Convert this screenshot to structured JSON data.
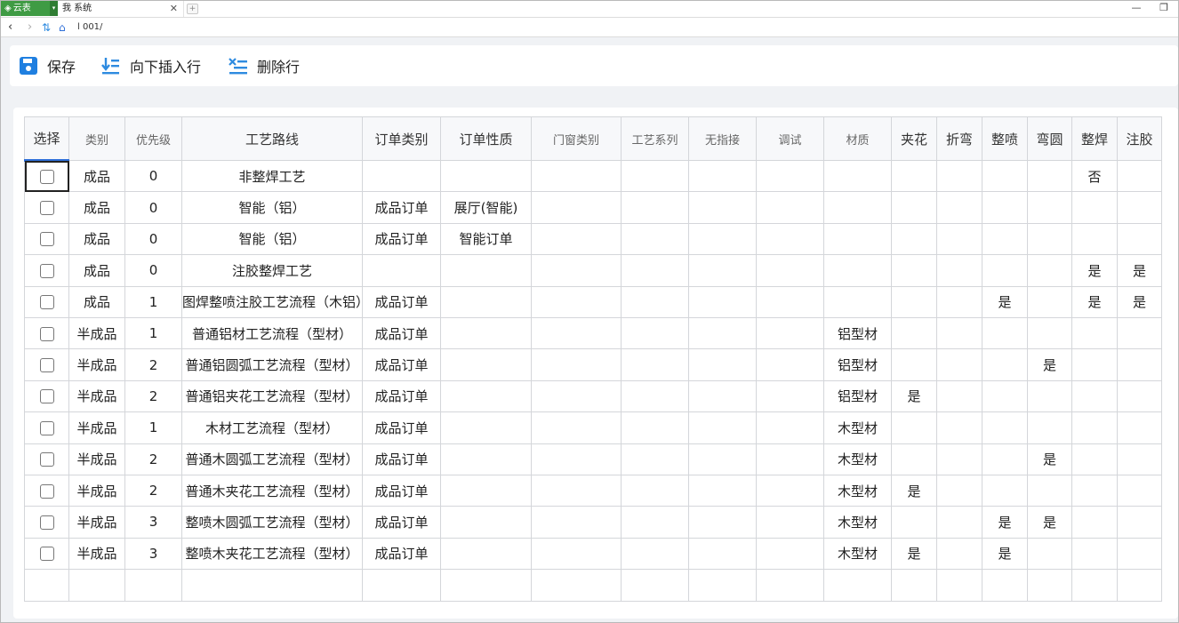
{
  "browser": {
    "brand": "云表",
    "tab_title": "我   系统",
    "url": "l              001/"
  },
  "toolbar": {
    "save_label": "保存",
    "insert_label": "向下插入行",
    "delete_label": "删除行"
  },
  "grid": {
    "headers": [
      "选择",
      "类别",
      "优先级",
      "工艺路线",
      "订单类别",
      "订单性质",
      "门窗类别",
      "工艺系列",
      "无指接",
      "调试",
      "材质",
      "夹花",
      "折弯",
      "整喷",
      "弯圆",
      "整焊",
      "注胶"
    ],
    "rows": [
      [
        "",
        "成品",
        "0",
        "非整焊工艺",
        "",
        "",
        "",
        "",
        "",
        "",
        "",
        "",
        "",
        "",
        "",
        "否",
        ""
      ],
      [
        "",
        "成品",
        "0",
        "智能（铝）",
        "成品订单",
        "展厅(智能)",
        "",
        "",
        "",
        "",
        "",
        "",
        "",
        "",
        "",
        "",
        ""
      ],
      [
        "",
        "成品",
        "0",
        "智能（铝）",
        "成品订单",
        "智能订单",
        "",
        "",
        "",
        "",
        "",
        "",
        "",
        "",
        "",
        "",
        ""
      ],
      [
        "",
        "成品",
        "0",
        "注胶整焊工艺",
        "",
        "",
        "",
        "",
        "",
        "",
        "",
        "",
        "",
        "",
        "",
        "是",
        "是"
      ],
      [
        "",
        "成品",
        "1",
        "图焊整喷注胶工艺流程（木铝）",
        "成品订单",
        "",
        "",
        "",
        "",
        "",
        "",
        "",
        "",
        "是",
        "",
        "是",
        "是"
      ],
      [
        "",
        "半成品",
        "1",
        "普通铝材工艺流程（型材）",
        "成品订单",
        "",
        "",
        "",
        "",
        "",
        "铝型材",
        "",
        "",
        "",
        "",
        "",
        ""
      ],
      [
        "",
        "半成品",
        "2",
        "普通铝圆弧工艺流程（型材）",
        "成品订单",
        "",
        "",
        "",
        "",
        "",
        "铝型材",
        "",
        "",
        "",
        "是",
        "",
        ""
      ],
      [
        "",
        "半成品",
        "2",
        "普通铝夹花工艺流程（型材）",
        "成品订单",
        "",
        "",
        "",
        "",
        "",
        "铝型材",
        "是",
        "",
        "",
        "",
        "",
        ""
      ],
      [
        "",
        "半成品",
        "1",
        "木材工艺流程（型材）",
        "成品订单",
        "",
        "",
        "",
        "",
        "",
        "木型材",
        "",
        "",
        "",
        "",
        "",
        ""
      ],
      [
        "",
        "半成品",
        "2",
        "普通木圆弧工艺流程（型材）",
        "成品订单",
        "",
        "",
        "",
        "",
        "",
        "木型材",
        "",
        "",
        "",
        "是",
        "",
        ""
      ],
      [
        "",
        "半成品",
        "2",
        "普通木夹花工艺流程（型材）",
        "成品订单",
        "",
        "",
        "",
        "",
        "",
        "木型材",
        "是",
        "",
        "",
        "",
        "",
        ""
      ],
      [
        "",
        "半成品",
        "3",
        "整喷木圆弧工艺流程（型材）",
        "成品订单",
        "",
        "",
        "",
        "",
        "",
        "木型材",
        "",
        "",
        "是",
        "是",
        "",
        ""
      ],
      [
        "",
        "半成品",
        "3",
        "整喷木夹花工艺流程（型材）",
        "成品订单",
        "",
        "",
        "",
        "",
        "",
        "木型材",
        "是",
        "",
        "是",
        "",
        "",
        ""
      ]
    ]
  },
  "colors": {
    "accent": "#2e6fd8",
    "brand": "#3f9b44"
  }
}
